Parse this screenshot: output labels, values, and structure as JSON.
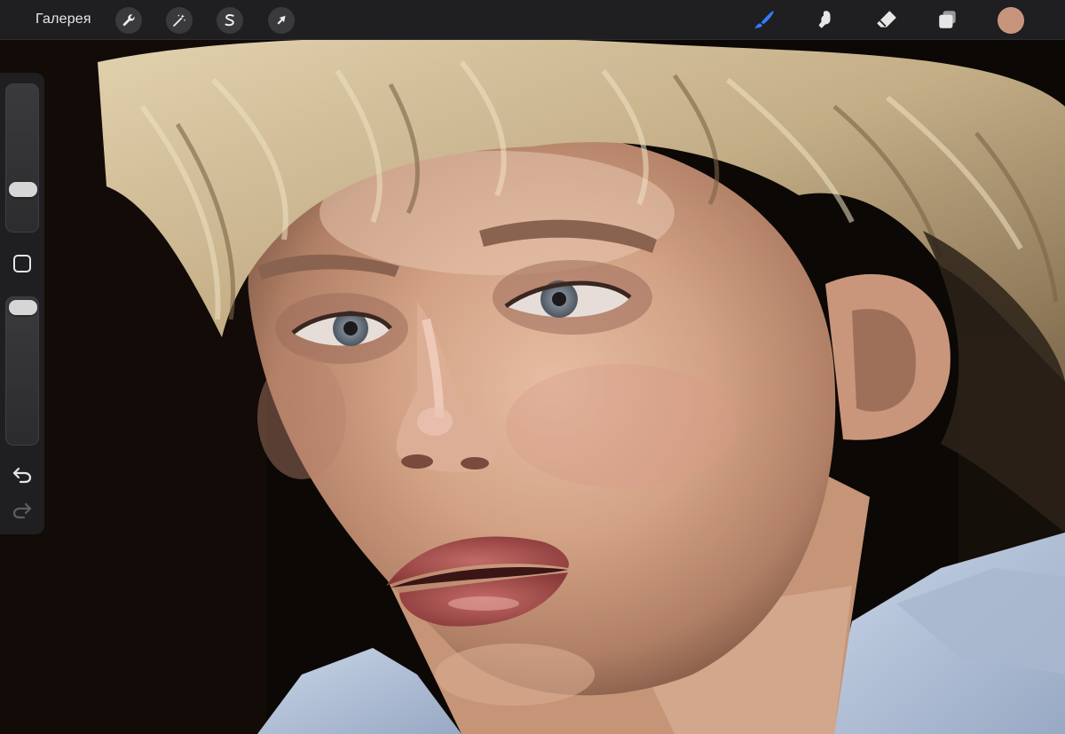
{
  "app": {
    "gallery_label": "Галерея"
  },
  "toolbar": {
    "left_tools": [
      {
        "name": "actions",
        "icon": "wrench-icon"
      },
      {
        "name": "adjustments",
        "icon": "magic-wand-icon"
      },
      {
        "name": "selection",
        "icon": "selection-s-icon"
      },
      {
        "name": "transform",
        "icon": "arrow-cursor-icon"
      }
    ],
    "right_tools": [
      {
        "name": "brush",
        "icon": "brush-icon",
        "active": true
      },
      {
        "name": "smudge",
        "icon": "smudge-finger-icon",
        "active": false
      },
      {
        "name": "eraser",
        "icon": "eraser-icon",
        "active": false
      },
      {
        "name": "layers",
        "icon": "layers-icon",
        "active": false
      }
    ],
    "active_color": "#c8937b",
    "active_tool_color": "#2f7dff"
  },
  "sidebar": {
    "brush_size_level": 0.25,
    "opacity_level": 1.0,
    "modify_icon": "square-outline-icon",
    "undo_icon": "undo-arrow-icon",
    "redo_icon": "redo-arrow-icon"
  },
  "canvas": {
    "description_icon": "painting-canvas",
    "colors": {
      "background": "#0c0806",
      "skin_mid": "#c99779",
      "skin_light": "#e3b9a0",
      "hair": "#cdb994",
      "shirt": "#b7c6da"
    }
  }
}
